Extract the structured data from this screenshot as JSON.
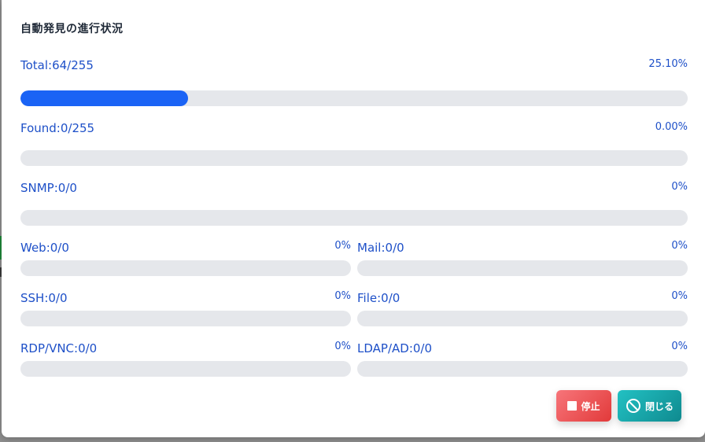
{
  "dialog": {
    "title": "自動発見の進行状況"
  },
  "progress": {
    "total": {
      "label": "Total:64/255",
      "percent_text": "25.10%",
      "value": 0.251
    },
    "found": {
      "label": "Found:0/255",
      "percent_text": "0.00%",
      "value": 0
    },
    "snmp": {
      "label": "SNMP:0/0",
      "percent_text": "0%",
      "value": 0
    },
    "web": {
      "label": "Web:0/0",
      "percent_text": "0%",
      "value": 0
    },
    "mail": {
      "label": "Mail:0/0",
      "percent_text": "0%",
      "value": 0
    },
    "ssh": {
      "label": "SSH:0/0",
      "percent_text": "0%",
      "value": 0
    },
    "file": {
      "label": "File:0/0",
      "percent_text": "0%",
      "value": 0
    },
    "rdp": {
      "label": "RDP/VNC:0/0",
      "percent_text": "0%",
      "value": 0
    },
    "ldap": {
      "label": "LDAP/AD:0/0",
      "percent_text": "0%",
      "value": 0
    }
  },
  "buttons": {
    "stop_label": "停止",
    "stop_icon": "stop-square-icon",
    "close_label": "閉じる",
    "close_icon": "prohibited-circle-icon"
  },
  "colors": {
    "accent": "#1a63f5",
    "label_text": "#1e50c8",
    "track": "#e5e7eb",
    "stop_button": "#e23a3a",
    "close_button": "#0f8a8f"
  }
}
